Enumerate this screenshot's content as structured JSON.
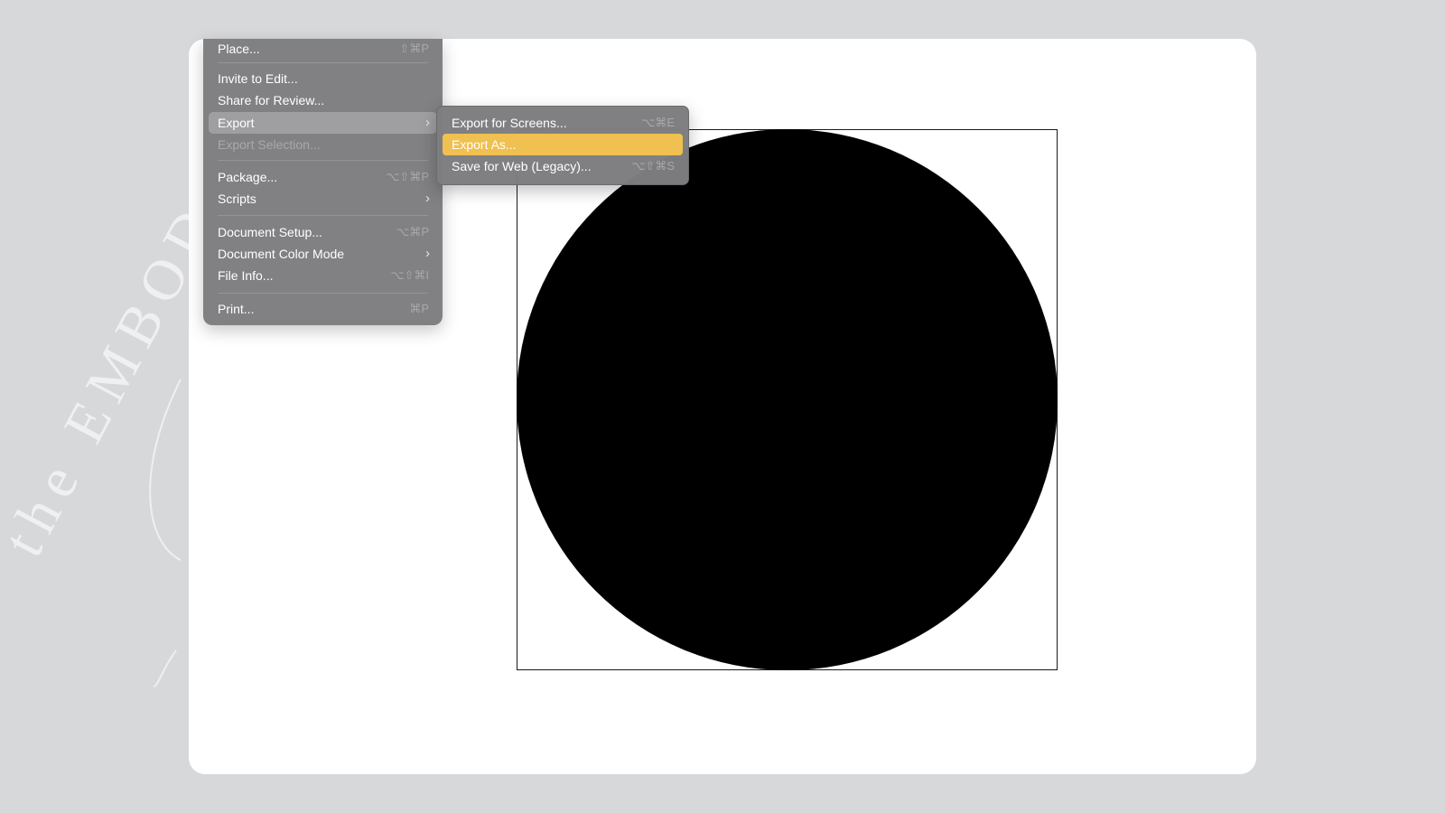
{
  "colors": {
    "background": "#d7d8da",
    "card": "#ffffff",
    "menu": "#7d7d7f",
    "menu_highlight": "#a0a0a2",
    "selected": "#f0c050",
    "shape": "#000000"
  },
  "menu": {
    "items": [
      {
        "label": "Place...",
        "shortcut": "⇧⌘P"
      },
      {
        "label": "Invite to Edit..."
      },
      {
        "label": "Share for Review..."
      },
      {
        "label": "Export",
        "submenu": true,
        "icon": "chevron-right-icon"
      },
      {
        "label": "Export Selection..."
      },
      {
        "label": "Package...",
        "shortcut": "⌥⇧⌘P"
      },
      {
        "label": "Scripts",
        "submenu": true,
        "icon": "chevron-right-icon"
      },
      {
        "label": "Document Setup...",
        "shortcut": "⌥⌘P"
      },
      {
        "label": "Document Color Mode",
        "submenu": true,
        "icon": "chevron-right-icon"
      },
      {
        "label": "File Info...",
        "shortcut": "⌥⇧⌘I"
      },
      {
        "label": "Print...",
        "shortcut": "⌘P"
      }
    ]
  },
  "submenu": {
    "items": [
      {
        "label": "Export for Screens...",
        "shortcut": "⌥⌘E"
      },
      {
        "label": "Export As..."
      },
      {
        "label": "Save for Web (Legacy)...",
        "shortcut": "⌥⇧⌘S"
      }
    ]
  },
  "watermark_text": "the EMBOD"
}
